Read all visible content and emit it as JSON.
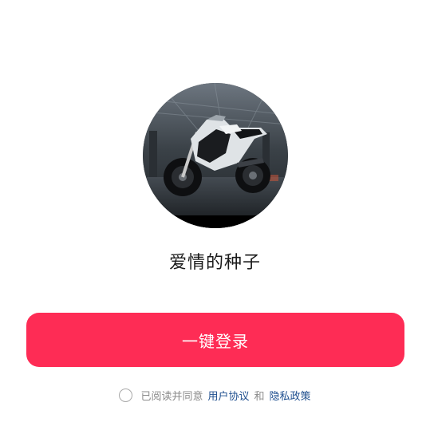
{
  "profile": {
    "avatar_alt": "motorcycle-photo",
    "username": "爱情的种子"
  },
  "login": {
    "button_label": "一键登录"
  },
  "agreement": {
    "prefix": "已阅读并同意",
    "user_agreement": "用户协议",
    "conjunction": "和",
    "privacy_policy": "隐私政策",
    "checked": false
  },
  "colors": {
    "accent": "#fe2c55",
    "link": "#1f4f8f",
    "muted_text": "#8a8a8a"
  }
}
